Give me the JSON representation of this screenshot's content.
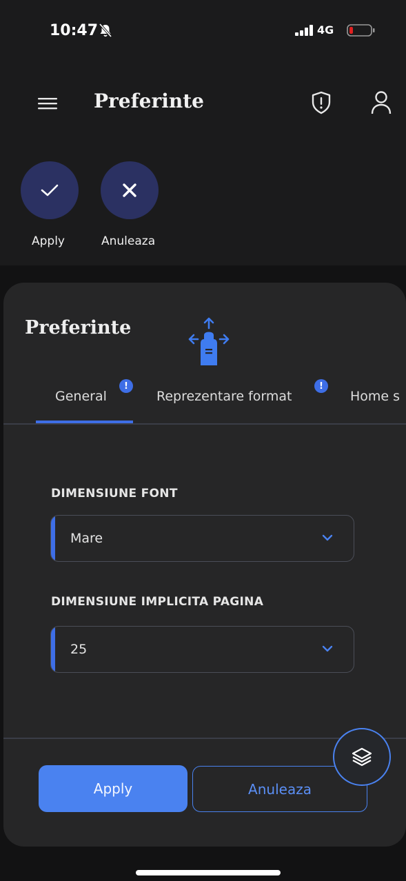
{
  "status_bar": {
    "time": "10:47",
    "network": "4G",
    "icons": [
      "bell-slash-icon",
      "signal-icon",
      "battery-low-icon"
    ]
  },
  "header": {
    "title": "Preferinte",
    "icons": [
      "menu-icon",
      "shield-alert-icon",
      "user-icon"
    ]
  },
  "quick_actions": {
    "apply_label": "Apply",
    "cancel_label": "Anuleaza",
    "icons": [
      "check-icon",
      "close-icon"
    ]
  },
  "panel": {
    "title": "Preferinte",
    "swipe_hint_icon": "swipe-hand-icon",
    "tabs": [
      {
        "label": "General",
        "badge": "!",
        "active": true
      },
      {
        "label": "Reprezentare format",
        "badge": "!",
        "active": false
      },
      {
        "label": "Home s",
        "badge": "",
        "active": false
      }
    ],
    "fields": [
      {
        "label": "DIMENSIUNE FONT",
        "value": "Mare"
      },
      {
        "label": "DIMENSIUNE IMPLICITA PAGINA",
        "value": "25"
      }
    ],
    "footer": {
      "apply_label": "Apply",
      "cancel_label": "Anuleaza",
      "fab_icon": "layers-icon"
    }
  },
  "colors": {
    "accent": "#4a82f0",
    "badge": "#3e6ee6",
    "quick_action_bg": "#2b3162",
    "panel_bg": "#262627",
    "battery_low": "#e02020"
  }
}
